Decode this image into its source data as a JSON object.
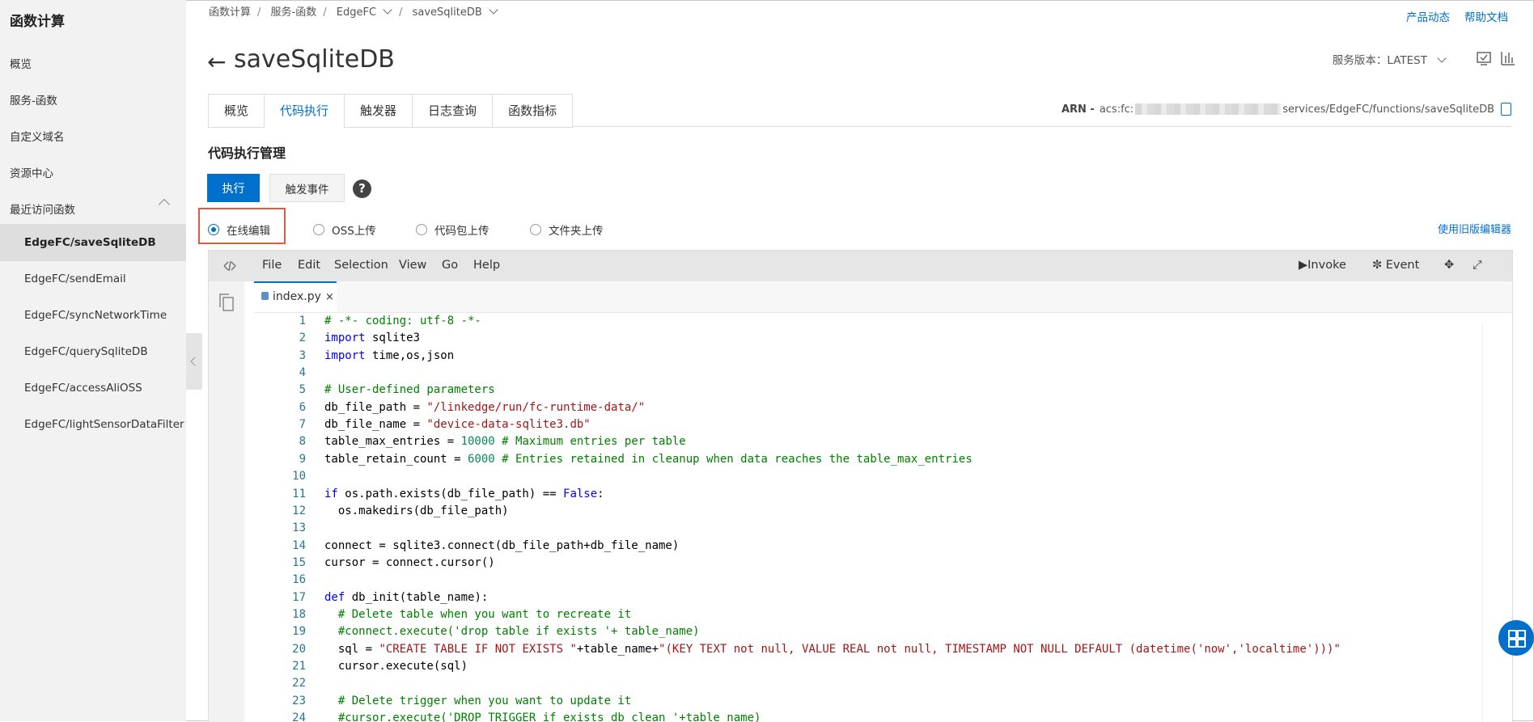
{
  "sidebar": {
    "title": "函数计算",
    "items": [
      "概览",
      "服务-函数",
      "自定义域名",
      "资源中心",
      "最近访问函数"
    ],
    "recent": [
      "EdgeFC/saveSqliteDB",
      "EdgeFC/sendEmail",
      "EdgeFC/syncNetworkTime",
      "EdgeFC/querySqliteDB",
      "EdgeFC/accessAliOSS",
      "EdgeFC/lightSensorDataFilter"
    ]
  },
  "breadcrumb": [
    "函数计算",
    "服务-函数",
    "EdgeFC",
    "saveSqliteDB"
  ],
  "top_links": [
    "产品动态",
    "帮助文档"
  ],
  "header": {
    "title": "saveSqliteDB",
    "version_label": "服务版本：LATEST"
  },
  "tabs": [
    "概览",
    "代码执行",
    "触发器",
    "日志查询",
    "函数指标"
  ],
  "active_tab": "代码执行",
  "arn": {
    "label": "ARN -",
    "prefix": "acs:fc:",
    "suffix": "services/EdgeFC/functions/saveSqliteDB"
  },
  "section": {
    "title": "代码执行管理",
    "exec_button": "执行",
    "trigger_button": "触发事件",
    "help": "?"
  },
  "upload_options": [
    "在线编辑",
    "OSS上传",
    "代码包上传",
    "文件夹上传"
  ],
  "selected_upload": "在线编辑",
  "old_editor_link": "使用旧版编辑器",
  "editor": {
    "menu": [
      "File",
      "Edit",
      "Selection",
      "View",
      "Go",
      "Help"
    ],
    "invoke": "Invoke",
    "event": "Event",
    "file_tab": "index.py",
    "close": "×",
    "code_lines": [
      [
        [
          "c",
          "# -*- coding: utf-8 -*-"
        ]
      ],
      [
        [
          "k",
          "import"
        ],
        [
          "p",
          " sqlite3"
        ]
      ],
      [
        [
          "k",
          "import"
        ],
        [
          "p",
          " time,os,json"
        ]
      ],
      [],
      [
        [
          "c",
          "# User-defined parameters"
        ]
      ],
      [
        [
          "p",
          "db_file_path = "
        ],
        [
          "s",
          "\"/linkedge/run/fc-runtime-data/\""
        ]
      ],
      [
        [
          "p",
          "db_file_name = "
        ],
        [
          "s",
          "\"device-data-sqlite3.db\""
        ]
      ],
      [
        [
          "p",
          "table_max_entries = "
        ],
        [
          "n",
          "10000"
        ],
        [
          "c",
          " # Maximum entries per table"
        ]
      ],
      [
        [
          "p",
          "table_retain_count = "
        ],
        [
          "n",
          "6000"
        ],
        [
          "c",
          " # Entries retained in cleanup when data reaches the table_max_entries"
        ]
      ],
      [],
      [
        [
          "k",
          "if"
        ],
        [
          "p",
          " os.path.exists(db_file_path) == "
        ],
        [
          "k",
          "False"
        ],
        [
          "p",
          ":"
        ]
      ],
      [
        [
          "p",
          "  os.makedirs(db_file_path)"
        ]
      ],
      [],
      [
        [
          "p",
          "connect = sqlite3.connect(db_file_path+db_file_name)"
        ]
      ],
      [
        [
          "p",
          "cursor = connect.cursor()"
        ]
      ],
      [],
      [
        [
          "k",
          "def"
        ],
        [
          "p",
          " db_init(table_name):"
        ]
      ],
      [
        [
          "c",
          "  # Delete table when you want to recreate it"
        ]
      ],
      [
        [
          "c",
          "  #connect.execute('drop table if exists '+ table_name)"
        ]
      ],
      [
        [
          "p",
          "  sql = "
        ],
        [
          "s",
          "\"CREATE TABLE IF NOT EXISTS \""
        ],
        [
          "p",
          "+table_name+"
        ],
        [
          "s",
          "\"(KEY TEXT not null, VALUE REAL not null, TIMESTAMP NOT NULL DEFAULT (datetime('now','localtime')))\""
        ]
      ],
      [
        [
          "p",
          "  cursor.execute(sql)"
        ]
      ],
      [],
      [
        [
          "c",
          "  # Delete trigger when you want to update it"
        ]
      ],
      [
        [
          "c",
          "  #cursor.execute('DROP TRIGGER if exists db_clean_'+table_name)"
        ]
      ]
    ]
  },
  "colors": {
    "accent": "#0070cc",
    "highlight_box": "#e25a3a",
    "comment": "#008000",
    "keyword": "#0000ff",
    "string": "#a31515",
    "number": "#09885a",
    "line_number": "#237893"
  }
}
